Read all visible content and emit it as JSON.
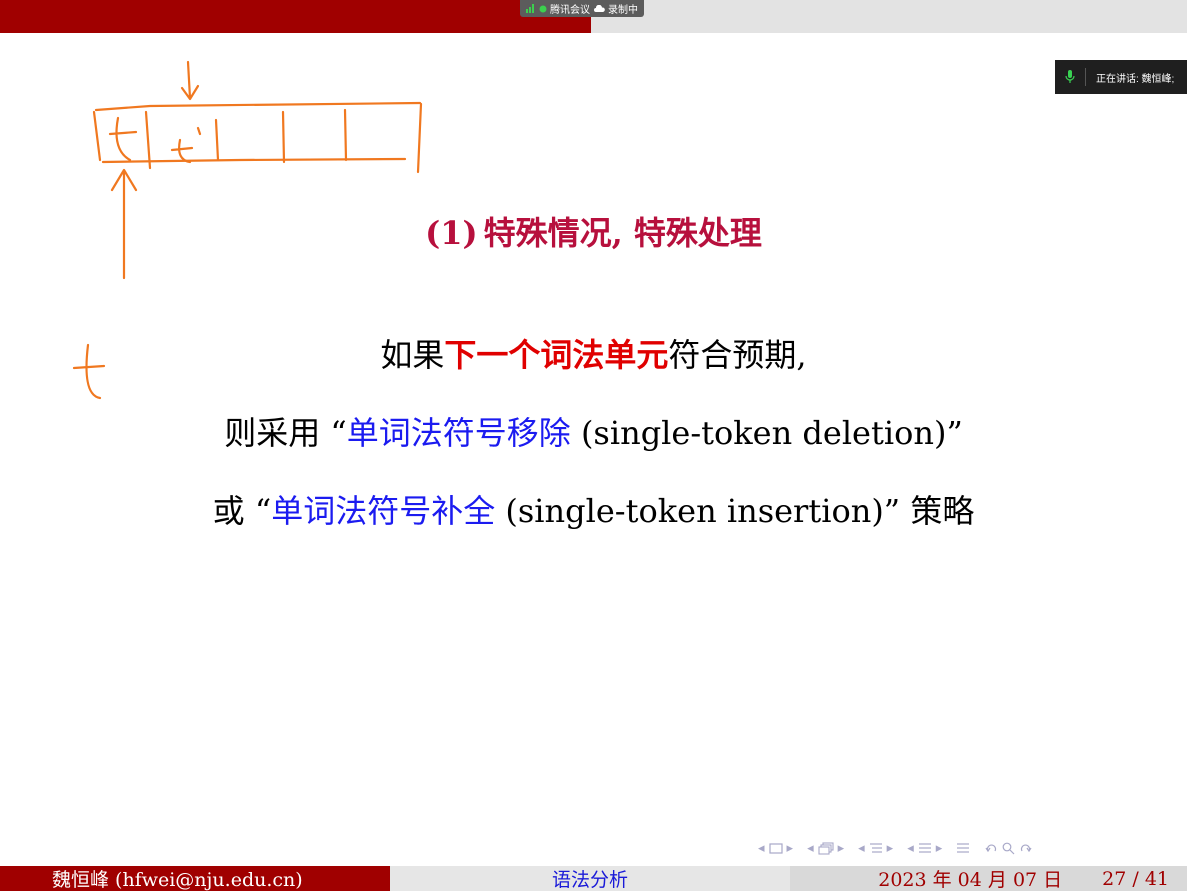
{
  "meeting_bar": {
    "app_label": "腾讯会议",
    "record_label": "录制中"
  },
  "speaking": {
    "label": "正在讲话: 魏恒峰;"
  },
  "slide": {
    "title_paren": "(1)",
    "title": "特殊情况, 特殊处理",
    "line1": {
      "pre": "如果",
      "strong": "下一个词法单元",
      "post": "符合预期,"
    },
    "line2": {
      "pre": "则采用 “",
      "blue": "单词法符号移除",
      "post": " (single-token deletion)”"
    },
    "line3": {
      "pre": "或 “",
      "blue": "单词法符号补全",
      "post": " (single-token insertion)” 策略"
    }
  },
  "annotation": {
    "letter_t": "t",
    "t_prime": "t'"
  },
  "footer": {
    "author": "魏恒峰  (hfwei@nju.edu.cn)",
    "section": "语法分析",
    "date": "2023 年 04 月 07 日",
    "page": "27 / 41"
  },
  "nav": {
    "icons": [
      "nav-prev-arrow",
      "frame-icon",
      "nav-next-arrow",
      "subsection-icon",
      "section-icon",
      "align-icon",
      "search-icon",
      "back-icon"
    ]
  },
  "colors": {
    "theme_red": "#a00000",
    "title_red": "#b7103d",
    "highlight_red": "#e00000",
    "link_blue": "#1b1bf0",
    "ink_orange": "#f07820"
  }
}
